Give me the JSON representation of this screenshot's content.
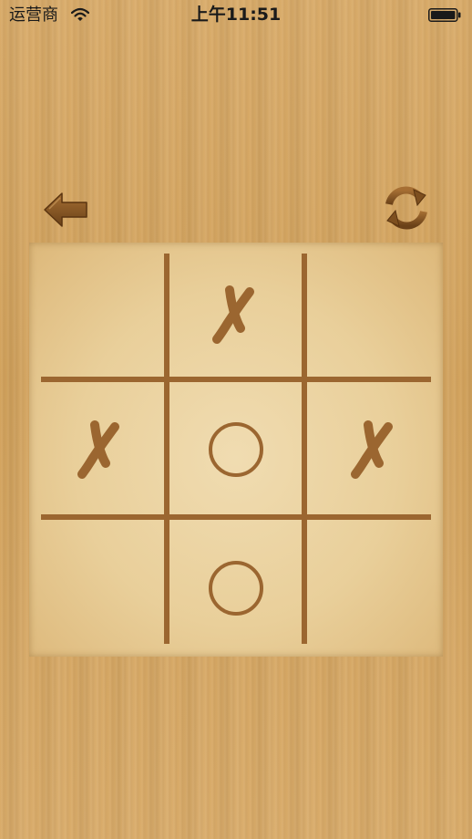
{
  "status_bar": {
    "carrier": "运营商",
    "time": "上午11:51"
  },
  "toolbar": {
    "back_icon": "back-arrow-icon",
    "refresh_icon": "refresh-icon"
  },
  "board": {
    "cells": [
      {
        "index": 0,
        "mark": ""
      },
      {
        "index": 1,
        "mark": "X"
      },
      {
        "index": 2,
        "mark": ""
      },
      {
        "index": 3,
        "mark": "X"
      },
      {
        "index": 4,
        "mark": "O"
      },
      {
        "index": 5,
        "mark": "X"
      },
      {
        "index": 6,
        "mark": ""
      },
      {
        "index": 7,
        "mark": "O"
      },
      {
        "index": 8,
        "mark": ""
      }
    ]
  },
  "colors": {
    "wood": "#d2a25e",
    "board": "#ecd5a5",
    "mark": "#9b6630",
    "grid": "#9b6630"
  }
}
